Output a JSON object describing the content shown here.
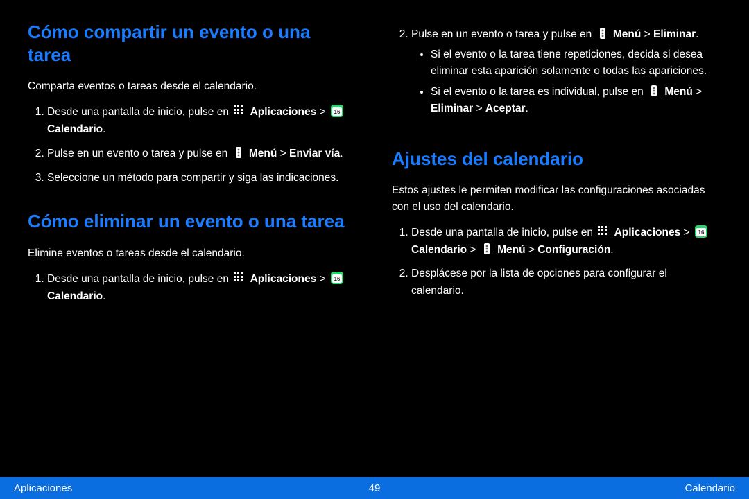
{
  "footer": {
    "left": "Aplicaciones",
    "page": "49",
    "right": "Calendario"
  },
  "sec_share": {
    "heading": "Cómo compartir un evento o una tarea",
    "intro": "Comparta eventos o tareas desde el calendario.",
    "step1_a": "Desde una pantalla de inicio, pulse en ",
    "step1_b": " Aplicaciones > ",
    "step1_c": " Calendario.",
    "step2_a": "Pulse en un evento o tarea y pulse en ",
    "step2_b": " Menú > Enviar vía.",
    "step3": "Seleccione un método para compartir y siga las indicaciones."
  },
  "sec_delete": {
    "heading": "Cómo eliminar un evento o una tarea",
    "intro": "Elimine eventos o tareas desde el calendario.",
    "step1_a": "Desde una pantalla de inicio, pulse en ",
    "step1_b": " Aplicaciones > ",
    "step1_c": " Calendario.",
    "step2_a": "Pulse en un evento o tarea y pulse en ",
    "step2_b": " Menú > Eliminar.",
    "step2_sub1": "Si el evento o la tarea tiene repeticiones, decida si desea eliminar esta aparición solamente o todas las apariciones.",
    "step2_sub2_a": "Si el evento o la tarea es individual, pulse en ",
    "step2_sub2_b": " Menú > Eliminar > Aceptar."
  },
  "sec_settings": {
    "heading": "Ajustes del calendario",
    "intro": "Estos ajustes le permiten modificar las configuraciones asociadas con el uso del calendario.",
    "step1_a": "Desde una pantalla de inicio, pulse en ",
    "step1_b": " Aplicaciones > ",
    "step1_c": " Calendario > ",
    "step1_d": " Menú > Configuración.",
    "step2": "Desplácese por la lista de opciones para configurar el calendario."
  },
  "labels": {
    "apps": "Aplicaciones",
    "calendar": "Calendario",
    "menu": "Menú",
    "send_via": "Enviar vía",
    "delete": "Eliminar",
    "accept": "Aceptar",
    "settings": "Configuración"
  }
}
